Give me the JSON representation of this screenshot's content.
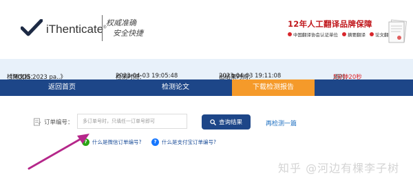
{
  "header": {
    "logo_text": "iThenticate",
    "logo_reg": "®",
    "slogan_line1": "权威准确",
    "slogan_line2": "安全快捷",
    "ad_title": "12年人工翻译品牌保障",
    "badges": [
      "中国翻译协会认证单位",
      "摘要翻译",
      "论文翻译"
    ]
  },
  "info": {
    "doc_label": "检测文档：",
    "doc_value": "《MQDS 2023 pa..》",
    "check_time_label": "检测时间：",
    "check_time_value": "2023-04-03 19:05:48",
    "result_time_label": "出结果时间：",
    "result_time_value": "2023-04-03 19:11:08",
    "duration_label": "用时：",
    "duration_value": "5分钟20秒"
  },
  "nav": {
    "items": [
      "返回首页",
      "检测论文",
      "下载检测报告"
    ],
    "active_index": 2
  },
  "form": {
    "order_label": "订单编号：",
    "order_placeholder": "多订单号时，只填任一订单号即可",
    "query_button": "查询结果",
    "recheck_link": "再检测一篇",
    "help_wechat": "什么是微信订单编号?",
    "help_alipay": "什么是支付宝订单编号?"
  },
  "watermark": "知乎 @河边有棵李子树",
  "colors": {
    "nav_bg": "#1d4688",
    "nav_active": "#f59a2a",
    "info_bg": "#e8f1fa",
    "accent_red": "#e0242a",
    "arrow": "#b5278a"
  }
}
